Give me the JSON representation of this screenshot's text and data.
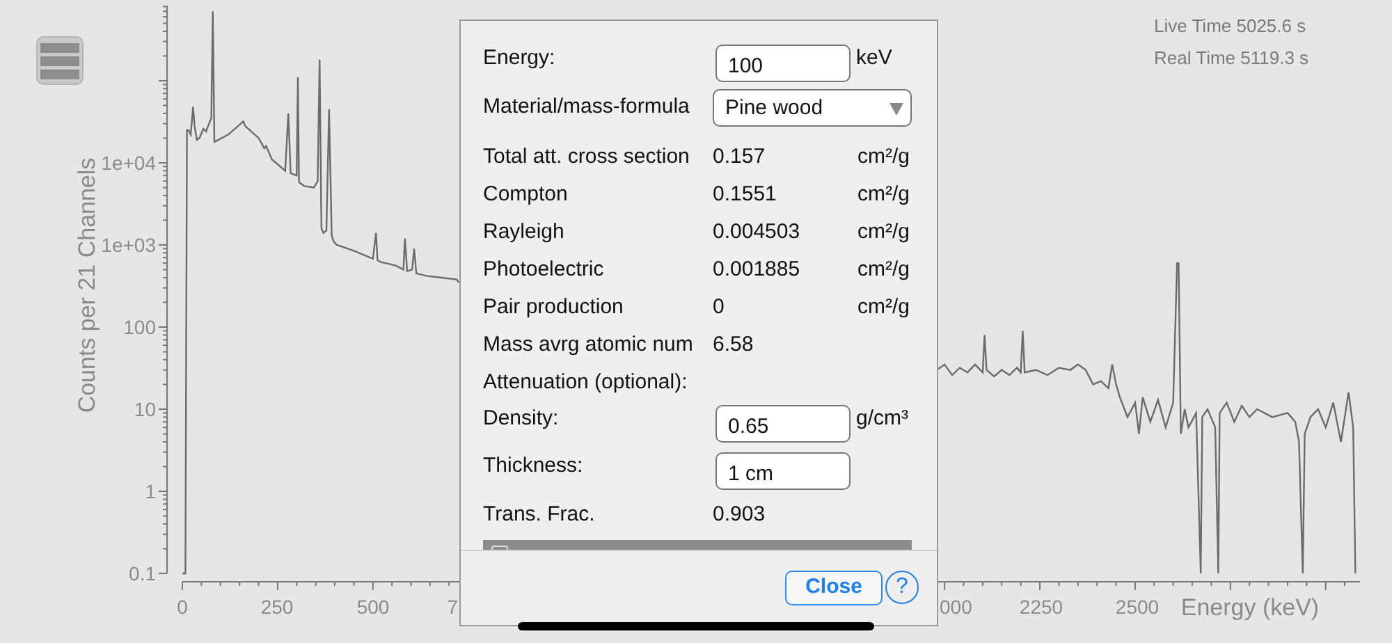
{
  "menu_button": {
    "kind": "menu"
  },
  "spectrum": {
    "info": [
      "Live Time 5025.6 s",
      "Real Time 5119.3 s"
    ],
    "x_axis": {
      "title": "Energy (keV)",
      "tick_labels": [
        "0",
        "250",
        "500",
        "7",
        "000",
        "2250",
        "2500"
      ]
    },
    "y_axis": {
      "title": "Counts per 21 Channels",
      "tick_labels": [
        "1e+04",
        "1e+03",
        "100",
        "10",
        "1",
        "0.1"
      ]
    }
  },
  "dialog": {
    "rows": [
      {
        "kind": "input",
        "label": "Energy:",
        "value": "100",
        "unit": "keV"
      },
      {
        "kind": "select",
        "label": "Material/mass-formula",
        "value": "Pine wood"
      },
      {
        "kind": "value",
        "label": "Total att. cross section",
        "value": "0.157",
        "unit": "cm²/g"
      },
      {
        "kind": "value",
        "label": "Compton",
        "value": "0.1551",
        "unit": "cm²/g"
      },
      {
        "kind": "value",
        "label": "Rayleigh",
        "value": "0.004503",
        "unit": "cm²/g"
      },
      {
        "kind": "value",
        "label": "Photoelectric",
        "value": "0.001885",
        "unit": "cm²/g"
      },
      {
        "kind": "value",
        "label": "Pair production",
        "value": "0",
        "unit": "cm²/g"
      },
      {
        "kind": "value",
        "label": "Mass avrg atomic num",
        "value": "6.58"
      },
      {
        "kind": "heading",
        "label": "Attenuation (optional):"
      },
      {
        "kind": "input",
        "label": "Density:",
        "value": "0.65",
        "unit": "g/cm³"
      },
      {
        "kind": "input",
        "label": "Thickness:",
        "value": "1 cm"
      },
      {
        "kind": "value",
        "label": "Trans. Frac.",
        "value": "0.903"
      }
    ],
    "close_button": "Close",
    "help_button": "?"
  }
}
